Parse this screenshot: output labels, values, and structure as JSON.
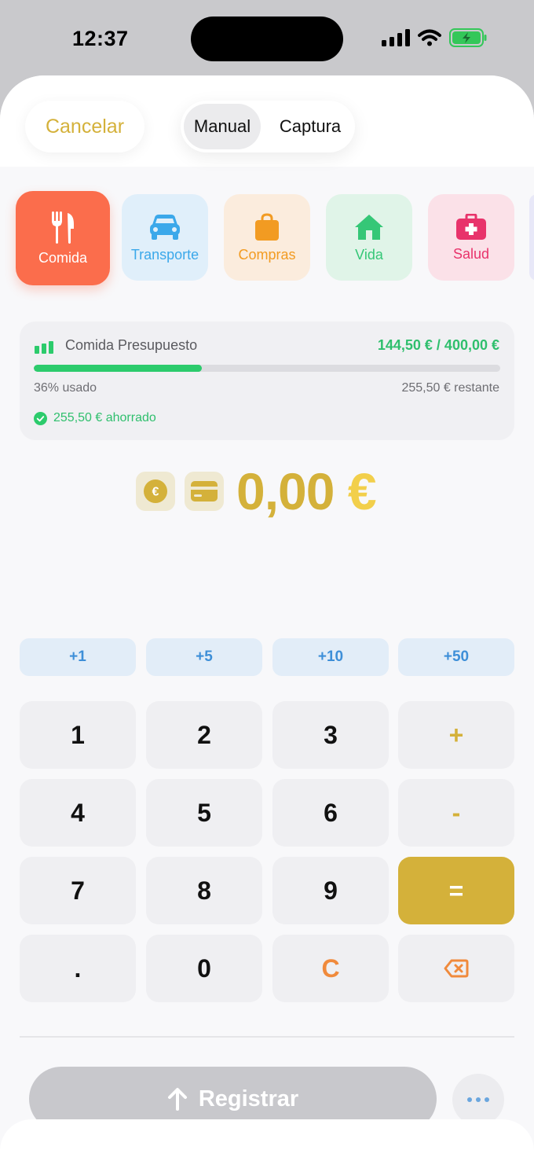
{
  "status_bar": {
    "time": "12:37",
    "battery_color": "#34c759"
  },
  "header": {
    "cancel_label": "Cancelar",
    "segment_active": "Manual",
    "segment_other": "Captura"
  },
  "categories": [
    {
      "label": "Comida",
      "icon": "fork-knife-icon",
      "color": "#fb6d4c",
      "selected": true
    },
    {
      "label": "Transporte",
      "icon": "car-icon",
      "color": "#3ba8ea"
    },
    {
      "label": "Compras",
      "icon": "shopping-bag-icon",
      "color": "#f29b22"
    },
    {
      "label": "Vida",
      "icon": "house-icon",
      "color": "#35c777"
    },
    {
      "label": "Salud",
      "icon": "medical-kit-icon",
      "color": "#e8336b"
    }
  ],
  "budget": {
    "title": "Comida Presupuesto",
    "amount": "144,50 € / 400,00 €",
    "progress_percent": 36,
    "used_label": "36% usado",
    "remaining_label": "255,50 € restante",
    "saved_label": "255,50 € ahorrado"
  },
  "amount_display": {
    "value": "0,00",
    "currency": "€"
  },
  "quick_add": [
    "+1",
    "+5",
    "+10",
    "+50"
  ],
  "keypad": {
    "k1": "1",
    "k2": "2",
    "k3": "3",
    "plus": "+",
    "k4": "4",
    "k5": "5",
    "k6": "6",
    "minus": "-",
    "k7": "7",
    "k8": "8",
    "k9": "9",
    "equals": "=",
    "dot": ".",
    "k0": "0",
    "clear": "C"
  },
  "submit_label": "Registrar",
  "colors": {
    "accent": "#d4b13a",
    "success": "#2ccb6c",
    "quick": "#3e8fd8",
    "clear": "#f08a3c"
  }
}
